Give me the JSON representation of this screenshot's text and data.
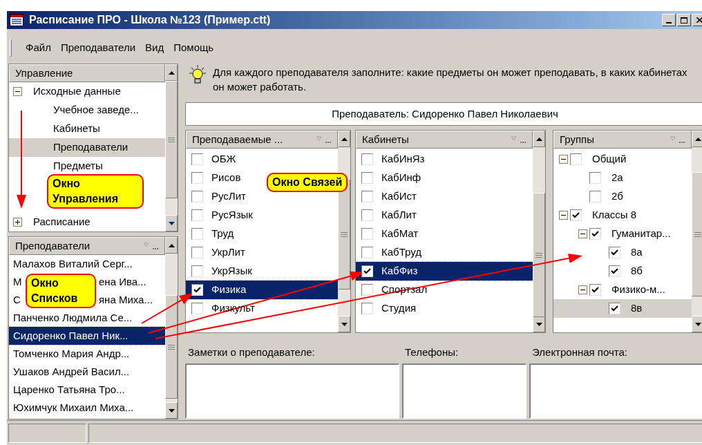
{
  "window": {
    "title": "Расписание ПРО - Школа №123 (Пример.ctt)"
  },
  "menu": [
    "Файл",
    "Преподаватели",
    "Вид",
    "Помощь"
  ],
  "control_panel": {
    "title": "Управление",
    "callout": "Окно Управления",
    "tree": [
      {
        "label": "Исходные данные",
        "expanded": true,
        "selected": false,
        "children": [
          {
            "label": "Учебное заведе...",
            "selected": false
          },
          {
            "label": "Кабинеты",
            "selected": false
          },
          {
            "label": "Преподаватели",
            "selected": true
          },
          {
            "label": "Предметы",
            "selected": false
          }
        ]
      },
      {
        "label": "Расписание",
        "expanded": false,
        "selected": false
      }
    ]
  },
  "list_panel": {
    "title": "Преподаватели",
    "callout": "Окно Списков",
    "rows": [
      {
        "parts": [
          "Малахов Виталий Серг..."
        ],
        "selected": false
      },
      {
        "parts": [
          "М",
          "ена Ива..."
        ],
        "selected": false
      },
      {
        "parts": [
          "С",
          "яна Миха..."
        ],
        "selected": false
      },
      {
        "parts": [
          "Панченко Людмила Се..."
        ],
        "selected": false
      },
      {
        "parts": [
          "Сидоренко Павел Ник..."
        ],
        "selected": true
      },
      {
        "parts": [
          "Томченко Мария Андр..."
        ],
        "selected": false
      },
      {
        "parts": [
          "Ушаков Андрей Васил..."
        ],
        "selected": false
      },
      {
        "parts": [
          "Царенко Татьяна Тро..."
        ],
        "selected": false
      },
      {
        "parts": [
          "Юхимчук Михаил Миха..."
        ],
        "selected": false
      }
    ]
  },
  "hint": "Для каждого преподавателя заполните: какие предметы он может преподавать, в каких кабинетах он может работать.",
  "teacher_header": "Преподаватель: Сидоренко Павел Николаевич",
  "links_callout": "Окно Связей",
  "subjects": {
    "title": "Преподаваемые ...",
    "items": [
      {
        "label": "ОБЖ",
        "checked": false,
        "selected": false
      },
      {
        "label": "Рисов",
        "checked": false,
        "selected": false
      },
      {
        "label": "РусЛит",
        "checked": false,
        "selected": false
      },
      {
        "label": "РусЯзык",
        "checked": false,
        "selected": false
      },
      {
        "label": "Труд",
        "checked": false,
        "selected": false
      },
      {
        "label": "УкрЛит",
        "checked": false,
        "selected": false
      },
      {
        "label": "УкрЯзык",
        "checked": false,
        "selected": false
      },
      {
        "label": "Физика",
        "checked": true,
        "selected": true
      },
      {
        "label": "Физкульт",
        "checked": false,
        "selected": false
      }
    ]
  },
  "rooms": {
    "title": "Кабинеты",
    "items": [
      {
        "label": "КабИнЯз",
        "checked": false,
        "selected": false
      },
      {
        "label": "КабИнф",
        "checked": false,
        "selected": false
      },
      {
        "label": "КабИст",
        "checked": false,
        "selected": false
      },
      {
        "label": "КабЛит",
        "checked": false,
        "selected": false
      },
      {
        "label": "КабМат",
        "checked": false,
        "selected": false
      },
      {
        "label": "КабТруд",
        "checked": false,
        "selected": false
      },
      {
        "label": "КабФиз",
        "checked": true,
        "selected": true
      },
      {
        "label": "Спортзал",
        "checked": false,
        "selected": false
      },
      {
        "label": "Студия",
        "checked": false,
        "selected": false
      }
    ]
  },
  "groups": {
    "title": "Группы",
    "tree": [
      {
        "children": [
          {
            "label": "Общий",
            "checked": false,
            "expanded": true,
            "selected": false,
            "children": [
              {
                "label": "2а",
                "checked": false,
                "selected": false
              },
              {
                "label": "2б",
                "checked": false,
                "selected": false
              }
            ]
          }
        ]
      },
      {
        "label": "Классы 8",
        "checked": true,
        "expanded": true,
        "selected": false,
        "children": [
          {
            "label": "Гуманитар...",
            "checked": true,
            "expanded": true,
            "selected": false,
            "children": [
              {
                "label": "8а",
                "checked": true,
                "selected": false
              },
              {
                "label": "8б",
                "checked": true,
                "selected": false
              }
            ]
          },
          {
            "label": "Физико-м...",
            "checked": true,
            "expanded": true,
            "selected": false,
            "children": [
              {
                "label": "8в",
                "checked": true,
                "selected": true
              }
            ]
          }
        ]
      }
    ]
  },
  "notes": [
    {
      "label": "Заметки о преподавателе:"
    },
    {
      "label": "Телефоны:"
    },
    {
      "label": "Электронная почта:"
    }
  ]
}
